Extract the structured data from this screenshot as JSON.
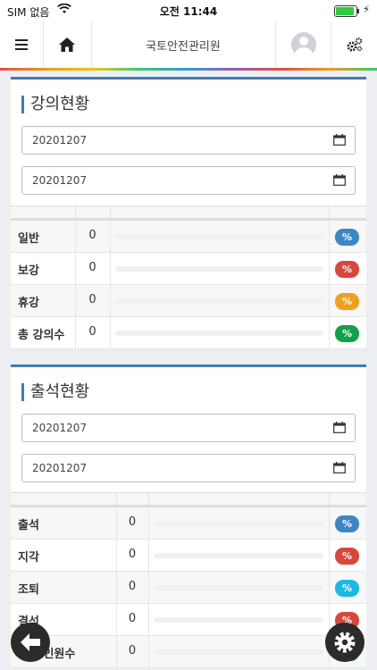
{
  "status_bar": {
    "carrier": "SIM 없음",
    "time": "오전 11:44"
  },
  "nav": {
    "title": "국토안전관리원"
  },
  "lecture": {
    "title": "강의현황",
    "start_date": "20201207",
    "end_date": "20201207",
    "rows": [
      {
        "label": "일반",
        "count": "0",
        "pct": "%",
        "color": "#3d86c6"
      },
      {
        "label": "보강",
        "count": "0",
        "pct": "%",
        "color": "#d9473b"
      },
      {
        "label": "휴강",
        "count": "0",
        "pct": "%",
        "color": "#f0a01a"
      },
      {
        "label": "총 강의수",
        "count": "0",
        "pct": "%",
        "color": "#12a14b"
      }
    ]
  },
  "attendance": {
    "title": "출석현황",
    "start_date": "20201207",
    "end_date": "20201207",
    "rows": [
      {
        "label": "출석",
        "count": "0",
        "pct": "%",
        "color": "#3d86c6"
      },
      {
        "label": "지각",
        "count": "0",
        "pct": "%",
        "color": "#d9473b"
      },
      {
        "label": "조퇴",
        "count": "0",
        "pct": "%",
        "color": "#1ab9e6"
      },
      {
        "label": "결석",
        "count": "0",
        "pct": "%",
        "color": "#d9473b"
      },
      {
        "label": "수강 인원수",
        "count": "0",
        "pct": "%",
        "color": "#12a14b"
      }
    ]
  }
}
